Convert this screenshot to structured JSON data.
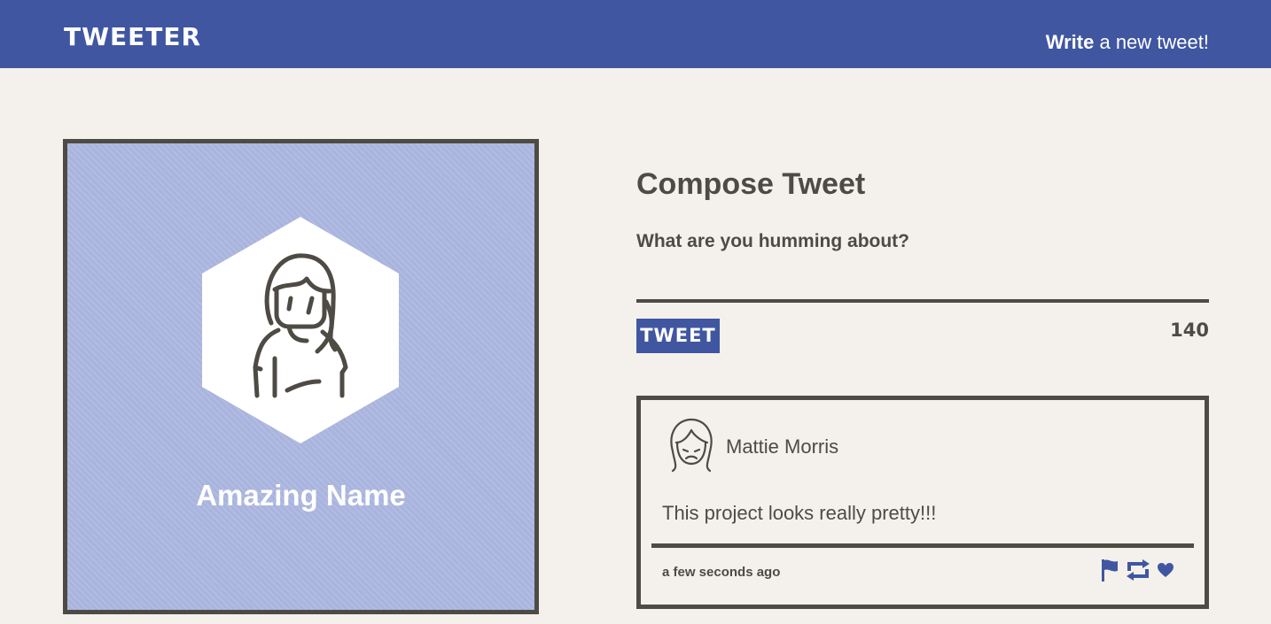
{
  "nav": {
    "brand": "TWEETER",
    "write_strong": "Write",
    "write_rest": " a new tweet!"
  },
  "profile": {
    "name": "Amazing Name",
    "avatar_icon": "woman-avatar-icon",
    "background_color": "#a9b4de"
  },
  "compose": {
    "title": "Compose Tweet",
    "label": "What are you humming about?",
    "textarea_value": "",
    "button_label": "TWEET",
    "counter": "140"
  },
  "tweet": {
    "author": "Mattie Morris",
    "avatar_icon": "sad-face-avatar-icon",
    "body": "This project looks really pretty!!!",
    "timestamp": "a few seconds ago",
    "actions": [
      "flag-icon",
      "retweet-icon",
      "heart-icon"
    ]
  },
  "colors": {
    "brand": "#4056a1",
    "text": "#4e4b45",
    "background": "#f4f1ec"
  }
}
